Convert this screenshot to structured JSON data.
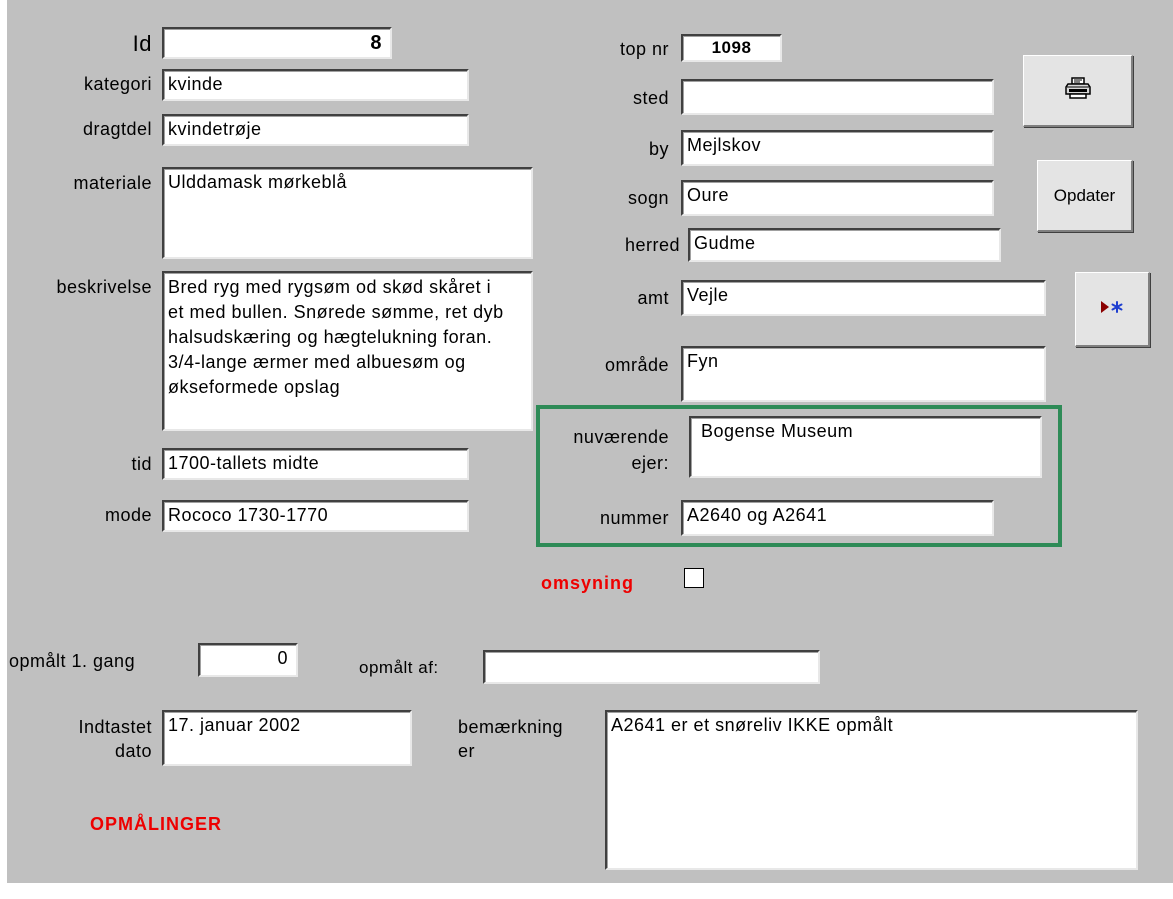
{
  "fields": {
    "id": {
      "label": "Id",
      "value": "8"
    },
    "kategori": {
      "label": "kategori",
      "value": "kvinde"
    },
    "dragtdel": {
      "label": "dragtdel",
      "value": "kvindetrøje"
    },
    "materiale": {
      "label": "materiale",
      "value": "Ulddamask mørkeblå"
    },
    "beskrivelse": {
      "label": "beskrivelse",
      "value": "Bred ryg med rygsøm od skød skåret i et med bullen. Snørede sømme, ret dyb halsudskæring og hægtelukning foran. 3/4-lange ærmer med albuesøm og økseformede opslag"
    },
    "tid": {
      "label": "tid",
      "value": "1700-tallets midte"
    },
    "mode": {
      "label": "mode",
      "value": "Rococo 1730-1770"
    },
    "top_nr": {
      "label": "top nr",
      "value": "1098"
    },
    "sted": {
      "label": "sted",
      "value": ""
    },
    "by": {
      "label": "by",
      "value": "Mejlskov"
    },
    "sogn": {
      "label": "sogn",
      "value": "Oure"
    },
    "herred": {
      "label": "herred",
      "value": "Gudme"
    },
    "amt": {
      "label": "amt",
      "value": "Vejle"
    },
    "omraade": {
      "label": "område",
      "value": "Fyn"
    },
    "nuvaerende_ejer": {
      "label_line1": "nuværende",
      "label_line2": "ejer:",
      "value": "Bogense Museum"
    },
    "nummer": {
      "label": "nummer",
      "value": "A2640 og A2641"
    },
    "omsyning": {
      "label": "omsyning",
      "checked": false
    },
    "opmaalt_1_gang": {
      "label": "opmålt 1. gang",
      "value": "0"
    },
    "opmaalt_af": {
      "label": "opmålt af:",
      "value": ""
    },
    "indtastet_dato": {
      "label_line1": "Indtastet",
      "label_line2": "dato",
      "value": "17. januar 2002"
    },
    "bemaerkninger": {
      "label_line1": "bemærkning",
      "label_line2": "er",
      "value": "A2641 er et snøreliv IKKE opmålt"
    }
  },
  "buttons": {
    "print_icon": "printer-icon",
    "opdater": "Opdater",
    "new_record_icon": "new-record-icon"
  },
  "links": {
    "opmaalinger": "OPMÅLINGER"
  },
  "colors": {
    "background": "#c0c0c0",
    "group_border": "#2e8b57",
    "red_label": "#ee0000",
    "new_record_arrow": "#8b0000",
    "new_record_star": "#1f3fd0"
  }
}
